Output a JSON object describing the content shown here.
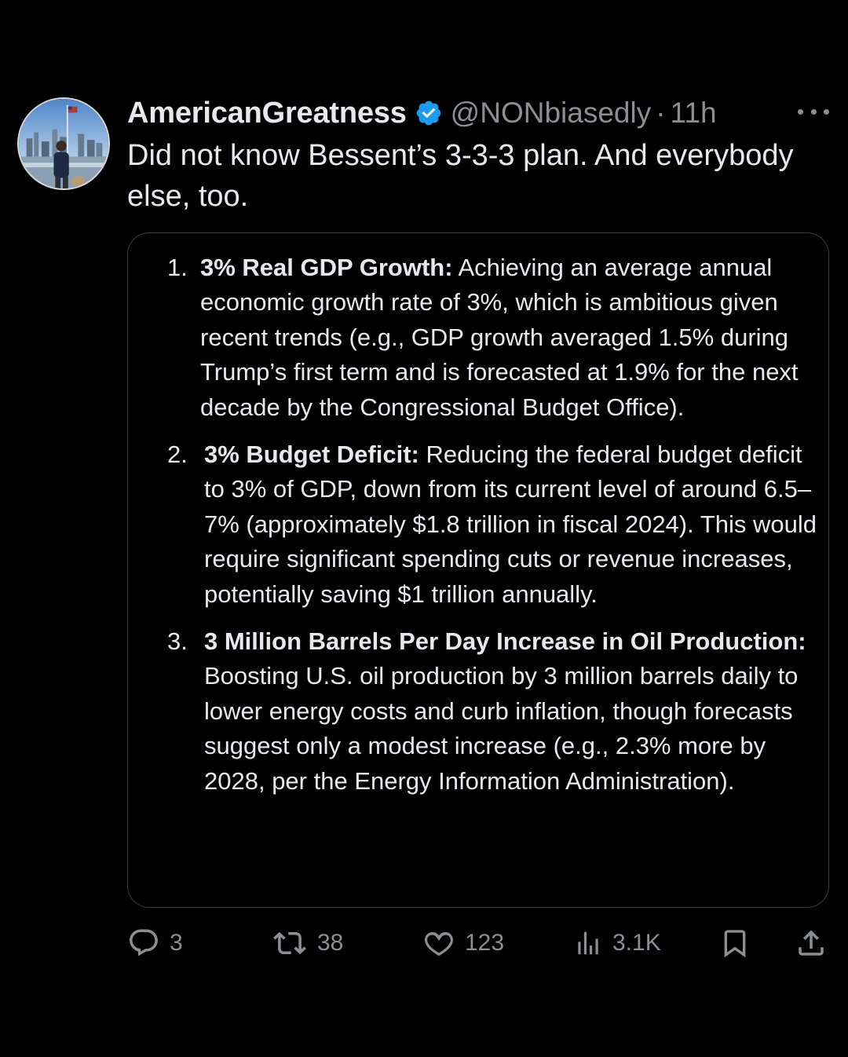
{
  "tweet": {
    "display_name": "AmericanGreatness",
    "handle": "@NONbiasedly",
    "separator": "·",
    "time": "11h",
    "text": "Did not know Bessent’s 3-3-3 plan. And everybody else, too.",
    "verified_color": "#1d9bf0",
    "more_icon": "more-horizontal-icon"
  },
  "card": {
    "items": [
      {
        "number": "1.",
        "title": "3% Real GDP Growth:",
        "text": " Achieving an average annual economic growth rate of 3%, which is ambitious given recent trends (e.g., GDP growth averaged 1.5% during Trump’s first term and is forecasted at 1.9% for the next decade by the Congressional Budget Office)."
      },
      {
        "number": "2.",
        "title": "3% Budget Deficit:",
        "text": " Reducing the federal budget deficit to 3% of GDP, down from its current level of around 6.5–7% (approximately $1.8 trillion in fiscal 2024). This would require significant spending cuts or revenue increases, potentially saving $1 trillion annually."
      },
      {
        "number": "3.",
        "title": "3 Million Barrels Per Day Increase in Oil Production:",
        "text": " Boosting U.S. oil production by 3 million barrels daily to lower energy costs and curb inflation, though forecasts suggest only a modest increase (e.g., 2.3% more by 2028, per the Energy Information Administration)."
      }
    ]
  },
  "actions": {
    "reply": {
      "icon": "reply-icon",
      "count": "3"
    },
    "repost": {
      "icon": "repost-icon",
      "count": "38"
    },
    "like": {
      "icon": "heart-icon",
      "count": "123"
    },
    "views": {
      "icon": "views-chart-icon",
      "count": "3.1K"
    },
    "bookmark": {
      "icon": "bookmark-icon"
    },
    "share": {
      "icon": "share-icon"
    }
  },
  "colors": {
    "background": "#000000",
    "text": "#e7e9ea",
    "secondary": "#8b8f94",
    "border": "#3a3d41"
  }
}
